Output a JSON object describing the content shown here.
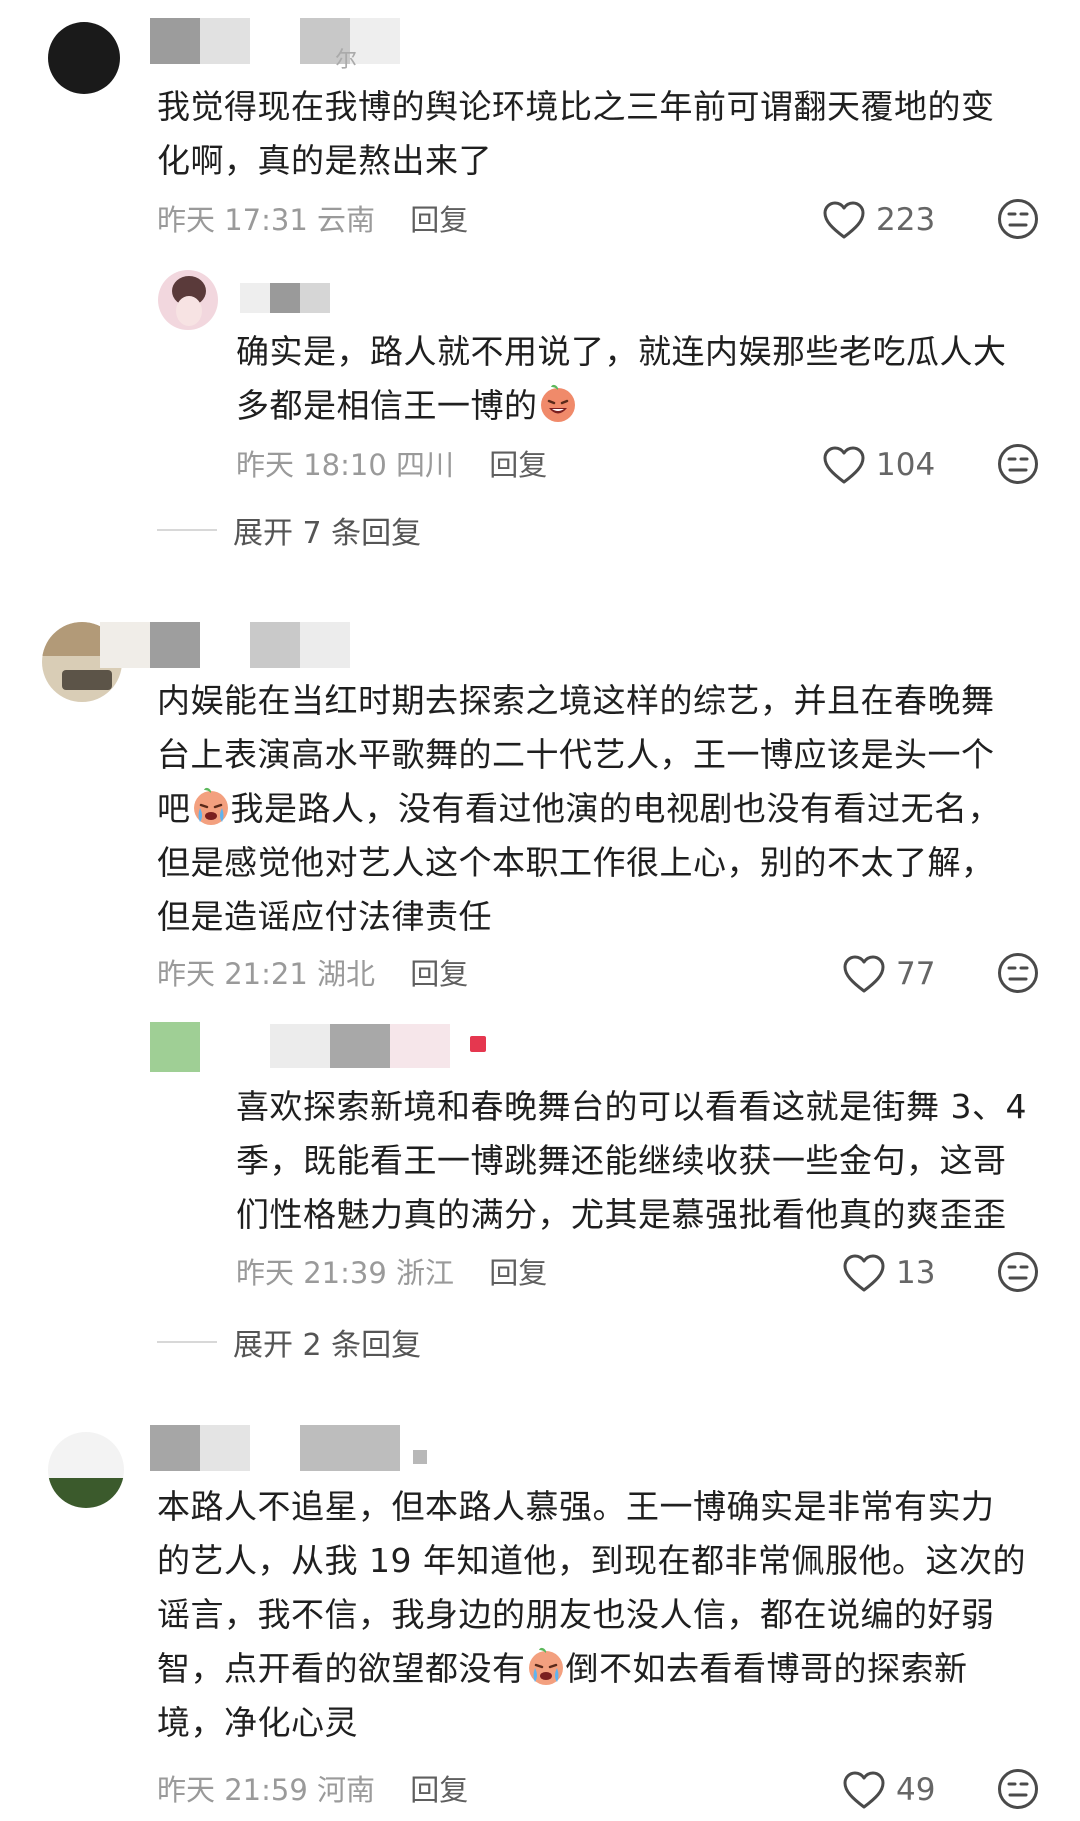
{
  "comments": [
    {
      "text_lines": [
        "我觉得现在我博的舆论环境比之三年前可谓翻天覆地的变",
        "化啊，真的是熬出来了"
      ],
      "time": "昨天 17:31 云南",
      "reply_label": "回复",
      "likes": "223",
      "name_fragment": "尔",
      "replies": [
        {
          "text_lines": [
            "确实是，路人就不用说了，就连内娱那些老吃瓜人大",
            "多都是相信王一博的"
          ],
          "time": "昨天 18:10 四川",
          "reply_label": "回复",
          "likes": "104"
        }
      ],
      "expand_label": "展开 7 条回复"
    },
    {
      "text_lines": [
        "内娱能在当红时期去探索之境这样的综艺，并且在春晚舞",
        "台上表演高水平歌舞的二十代艺人，王一博应该是头一个",
        "吧",
        "我是路人，没有看过他演的电视剧也没有看过无名，",
        "但是感觉他对艺人这个本职工作很上心，别的不太了解，",
        "但是造谣应付法律责任"
      ],
      "time": "昨天 21:21 湖北",
      "reply_label": "回复",
      "likes": "77",
      "replies": [
        {
          "text_lines": [
            "喜欢探索新境和春晚舞台的可以看看这就是街舞 3、4",
            "季，既能看王一博跳舞还能继续收获一些金句，这哥",
            "们性格魅力真的满分，尤其是慕强批看他真的爽歪歪"
          ],
          "time": "昨天 21:39 浙江",
          "reply_label": "回复",
          "likes": "13"
        }
      ],
      "expand_label": "展开 2 条回复"
    },
    {
      "text_lines": [
        "本路人不追星，但本路人慕强。王一博确实是非常有实力",
        "的艺人，从我 19 年知道他，到现在都非常佩服他。这次的",
        "谣言，我不信，我身边的朋友也没人信，都在说编的好弱",
        "智，点开看的欲望都没有",
        "倒不如去看看博哥的探索新",
        "境，净化心灵"
      ],
      "time": "昨天 21:59 河南",
      "reply_label": "回复",
      "likes": "49"
    }
  ],
  "icons": {
    "like": "heart-outline-icon",
    "dislike": "unamused-face-icon",
    "emoji_laugh": "laughing-face-emoji",
    "emoji_cry": "crying-face-emoji"
  },
  "colors": {
    "text": "#1f1f1f",
    "meta": "#9a9a9a",
    "reply": "#5f5f5f"
  }
}
